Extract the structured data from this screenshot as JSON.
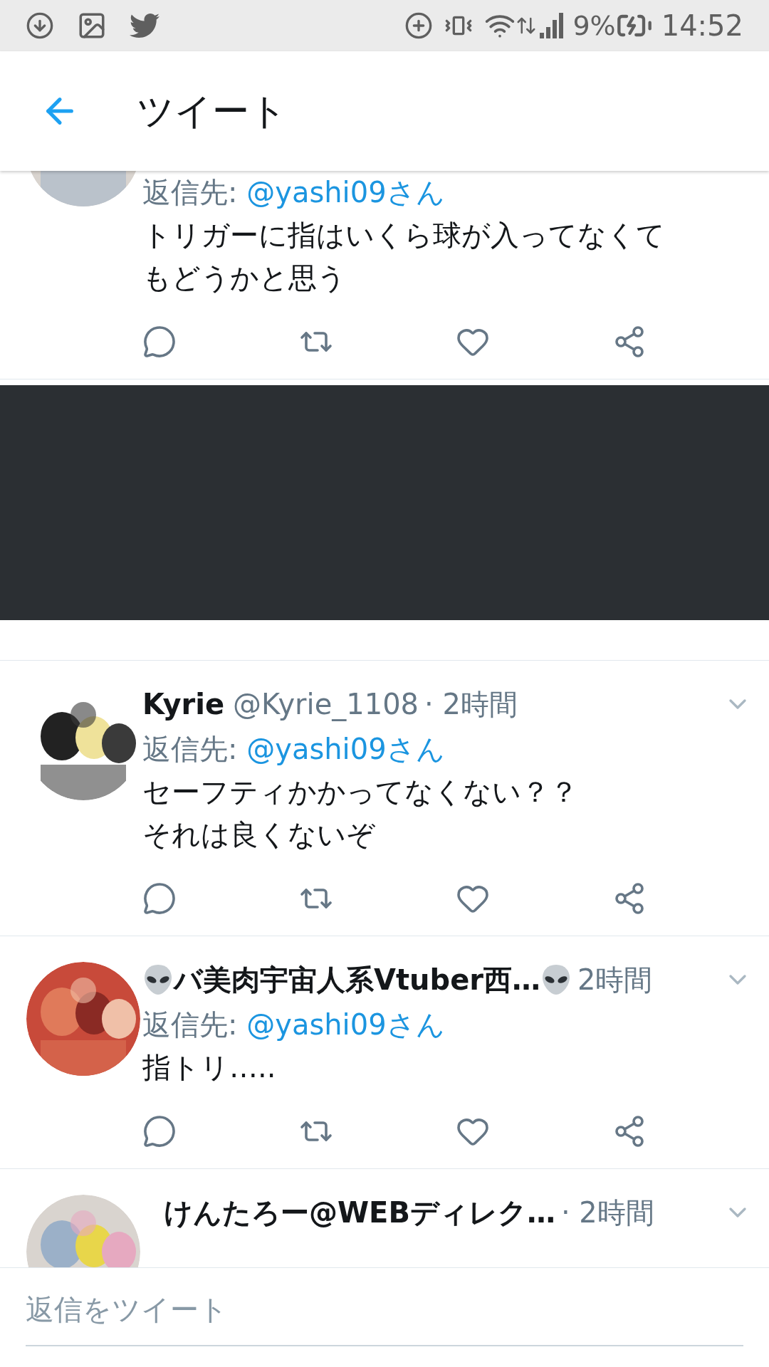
{
  "status_bar": {
    "battery": "9%",
    "time": "14:52"
  },
  "header": {
    "title": "ツイート"
  },
  "tweets": [
    {
      "kind": "cut_top",
      "reply_label": "返信先: ",
      "reply_to": "@yashi09さん",
      "lines": [
        "トリガーに指はいくら球が入ってなくて",
        "もどうかと思う"
      ]
    },
    {
      "kind": "redacted"
    },
    {
      "kind": "full",
      "name": "Kyrie",
      "handle": "@Kyrie_1108",
      "time": "· 2時間",
      "reply_label": "返信先: ",
      "reply_to": "@yashi09さん",
      "lines": [
        "セーフティかかってなくない？？",
        "それは良くないぞ"
      ]
    },
    {
      "kind": "full",
      "name": "バ美肉宇宙人系Vtuber西…",
      "flanked_by_icons": true,
      "time": "2時間",
      "reply_label": "返信先: ",
      "reply_to": "@yashi09さん",
      "lines": [
        "指トリ….."
      ]
    },
    {
      "kind": "cut_bottom",
      "name": "けんたろー@WEBディレク…",
      "time": "· 2時間"
    }
  ],
  "reply_box": {
    "placeholder": "返信をツイート"
  }
}
